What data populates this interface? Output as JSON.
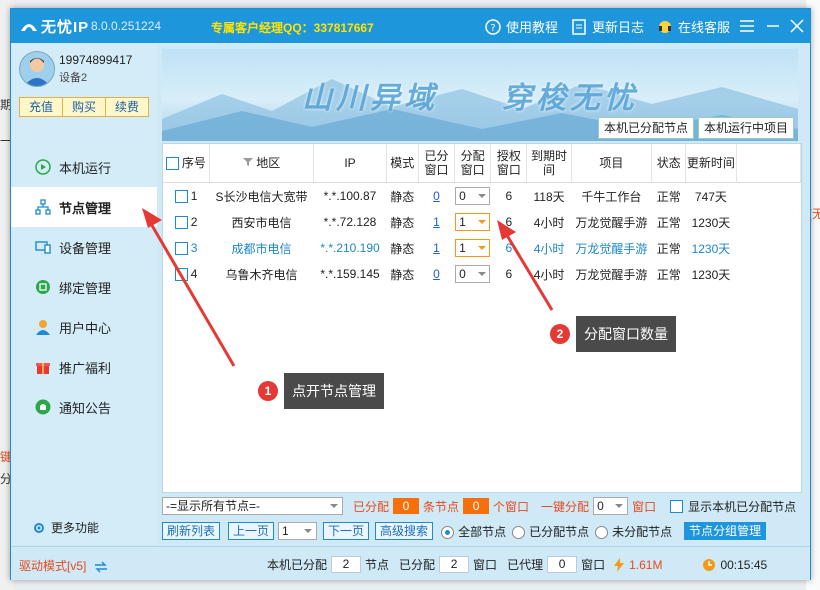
{
  "background": {
    "left_fragments": [
      "期",
      "一",
      "键",
      "分"
    ],
    "right_fragment": "(无"
  },
  "titlebar": {
    "app_name": "无忧IP",
    "version": "8.0.0.251224",
    "manager_label": "专属客户经理QQ：337817667",
    "help": "使用教程",
    "changelog": "更新日志",
    "service": "在线客服"
  },
  "account": {
    "user_id": "19974899417",
    "device": "设备2",
    "buttons": [
      "充值",
      "购买",
      "续费"
    ]
  },
  "nav": {
    "items": [
      {
        "label": "本机运行",
        "icon": "play-icon"
      },
      {
        "label": "节点管理",
        "icon": "network-icon"
      },
      {
        "label": "设备管理",
        "icon": "devices-icon"
      },
      {
        "label": "绑定管理",
        "icon": "bind-icon"
      },
      {
        "label": "用户中心",
        "icon": "user-icon"
      },
      {
        "label": "推广福利",
        "icon": "gift-icon"
      },
      {
        "label": "通知公告",
        "icon": "bell-icon"
      }
    ],
    "active": "节点管理",
    "more": "更多功能"
  },
  "banner": {
    "text1": "山川异域",
    "text2": "穿梭无忧",
    "tabs": [
      "本机已分配节点",
      "本机运行中项目"
    ]
  },
  "table": {
    "headers": [
      "序号",
      "地区",
      "IP",
      "模式",
      "已分窗口",
      "分配窗口",
      "授权窗口",
      "到期时间",
      "项目",
      "状态",
      "更新时间"
    ],
    "rows": [
      {
        "idx": "1",
        "region": "S长沙电信大宽带",
        "ip": "*.*.100.87",
        "mode": "静态",
        "allocated": "0",
        "assign": "0",
        "auth": "6",
        "expire": "118天",
        "project": "千牛工作台",
        "status": "正常",
        "update": "747天"
      },
      {
        "idx": "2",
        "region": "西安市电信",
        "ip": "*.*.72.128",
        "mode": "静态",
        "allocated": "1",
        "assign": "1",
        "auth": "6",
        "expire": "4小时",
        "project": "万龙觉醒手游",
        "status": "正常",
        "update": "1230天"
      },
      {
        "idx": "3",
        "region": "成都市电信",
        "ip": "*.*.210.190",
        "mode": "静态",
        "allocated": "1",
        "assign": "1",
        "auth": "6",
        "expire": "4小时",
        "project": "万龙觉醒手游",
        "status": "正常",
        "update": "1230天"
      },
      {
        "idx": "4",
        "region": "乌鲁木齐电信",
        "ip": "*.*.159.145",
        "mode": "静态",
        "allocated": "0",
        "assign": "0",
        "auth": "6",
        "expire": "4小时",
        "project": "万龙觉醒手游",
        "status": "正常",
        "update": "1230天"
      }
    ]
  },
  "filter_bar": {
    "node_filter": "-=显示所有节点=-",
    "allocated_label": "已分配",
    "allocated_nodes": "0",
    "nodes_unit": "条节点",
    "allocated_windows": "0",
    "windows_unit": "个窗口",
    "one_click_label": "一键分配",
    "one_click_value": "0",
    "window_label": "窗口",
    "show_local_label": "显示本机已分配节点"
  },
  "pager_bar": {
    "refresh": "刷新列表",
    "prev": "上一页",
    "page": "1",
    "next": "下一页",
    "advanced": "高级搜索",
    "radio_all": "全部节点",
    "radio_allocated": "已分配节点",
    "radio_unallocated": "未分配节点",
    "group_manage": "节点分组管理"
  },
  "status_bar": {
    "driver_mode": "驱动模式[v5]",
    "local_alloc_label": "本机已分配",
    "local_nodes": "2",
    "nodes_label": "节点",
    "alloc_label": "已分配",
    "alloc_windows": "2",
    "windows_label": "窗口",
    "proxy_label": "已代理",
    "proxy_windows": "0",
    "proxy_unit": "窗口",
    "speed": "1.61M",
    "timer": "00:15:45"
  },
  "annotations": [
    {
      "num": "1",
      "text": "点开节点管理"
    },
    {
      "num": "2",
      "text": "分配窗口数量"
    }
  ],
  "colors": {
    "accent": "#1e96dc",
    "highlight": "#f29b18",
    "annotation": "#e53935"
  }
}
